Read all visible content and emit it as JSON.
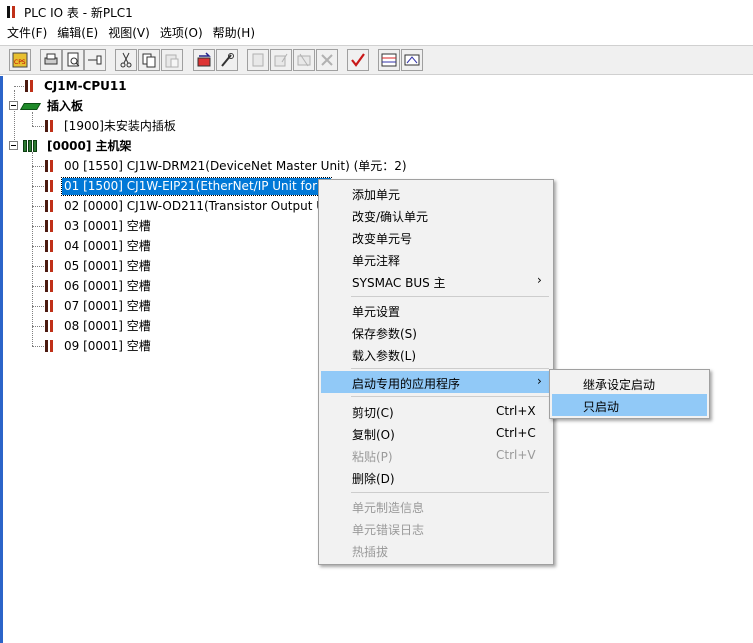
{
  "window": {
    "title": "PLC IO 表 - 新PLC1"
  },
  "menubar": [
    "文件(F)",
    "编辑(E)",
    "视图(V)",
    "选项(O)",
    "帮助(H)"
  ],
  "toolbar": {
    "buttons": [
      {
        "icon": "cps-icon"
      },
      {
        "icon": "print-icon"
      },
      {
        "icon": "print-preview-icon"
      },
      {
        "icon": "pin-icon"
      },
      {
        "icon": "cut-icon"
      },
      {
        "icon": "copy-icon"
      },
      {
        "icon": "paste-icon",
        "disabled": true
      },
      {
        "icon": "transfer-icon"
      },
      {
        "icon": "tools-icon"
      },
      {
        "icon": "unit-info-icon",
        "disabled": true
      },
      {
        "icon": "unit-edit-icon",
        "disabled": true
      },
      {
        "icon": "unit-remove-icon",
        "disabled": true
      },
      {
        "icon": "unit-delete-icon",
        "disabled": true
      },
      {
        "icon": "check-icon"
      },
      {
        "icon": "io-table-icon"
      },
      {
        "icon": "compare-icon"
      }
    ]
  },
  "tree": {
    "cpu": "CJ1M-CPU11",
    "inner_board": "插入板",
    "inner_board_child": "[1900]未安装内插板",
    "main_rack": "[0000] 主机架",
    "slots": [
      "00 [1550] CJ1W-DRM21(DeviceNet Master Unit) (单元：2)",
      "01 [1500] CJ1W-EIP21(EtherNet/IP Unit for C",
      "02 [0000] CJ1W-OD211(Transistor Output Ur",
      "03 [0001] 空槽",
      "04 [0001] 空槽",
      "05 [0001] 空槽",
      "06 [0001] 空槽",
      "07 [0001] 空槽",
      "08 [0001] 空槽",
      "09 [0001] 空槽"
    ],
    "selected_index": 1
  },
  "context_menu": {
    "items": [
      {
        "label": "添加单元"
      },
      {
        "label": "改变/确认单元"
      },
      {
        "label": "改变单元号"
      },
      {
        "label": "单元注释"
      },
      {
        "label": "SYSMAC BUS 主",
        "submenu": true
      },
      {
        "label": "单元设置"
      },
      {
        "label": "保存参数(S)"
      },
      {
        "label": "载入参数(L)"
      },
      {
        "label": "启动专用的应用程序",
        "submenu": true,
        "highlighted": true
      },
      {
        "label": "剪切(C)",
        "shortcut": "Ctrl+X"
      },
      {
        "label": "复制(O)",
        "shortcut": "Ctrl+C"
      },
      {
        "label": "粘贴(P)",
        "shortcut": "Ctrl+V",
        "disabled": true
      },
      {
        "label": "删除(D)"
      },
      {
        "label": "单元制造信息",
        "disabled": true
      },
      {
        "label": "单元错误日志",
        "disabled": true
      },
      {
        "label": "热插拔",
        "disabled": true
      }
    ],
    "arrow": "›"
  },
  "submenu": {
    "items": [
      {
        "label": "继承设定启动"
      },
      {
        "label": "只启动",
        "highlighted": true
      }
    ]
  },
  "colors": {
    "selection": "#0078d7",
    "menu_highlight": "#91c9f7",
    "disabled_text": "#9a9a9a"
  }
}
